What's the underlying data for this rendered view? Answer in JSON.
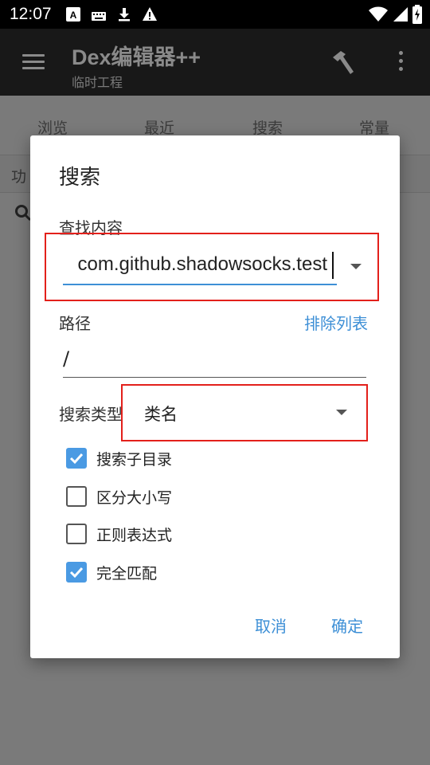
{
  "status_bar": {
    "time": "12:07"
  },
  "app_bar": {
    "title": "Dex编辑器++",
    "subtitle": "临时工程"
  },
  "tabs": [
    "浏览",
    "最近",
    "搜索",
    "常量"
  ],
  "background": {
    "row_text": "功"
  },
  "dialog": {
    "title": "搜索",
    "find_label": "查找内容",
    "find_value": "com.github.shadowsocks.test",
    "path_label": "路径",
    "exclude_link": "排除列表",
    "path_value": "/",
    "type_label": "搜索类型",
    "type_value": "类名",
    "checkboxes": [
      {
        "label": "搜索子目录",
        "checked": true
      },
      {
        "label": "区分大小写",
        "checked": false
      },
      {
        "label": "正则表达式",
        "checked": false
      },
      {
        "label": "完全匹配",
        "checked": true
      }
    ],
    "cancel_label": "取消",
    "ok_label": "确定"
  },
  "colors": {
    "accent": "#3d8fd6",
    "checkbox_checked": "#4a9ae3",
    "annotation_red": "#e3201b"
  }
}
